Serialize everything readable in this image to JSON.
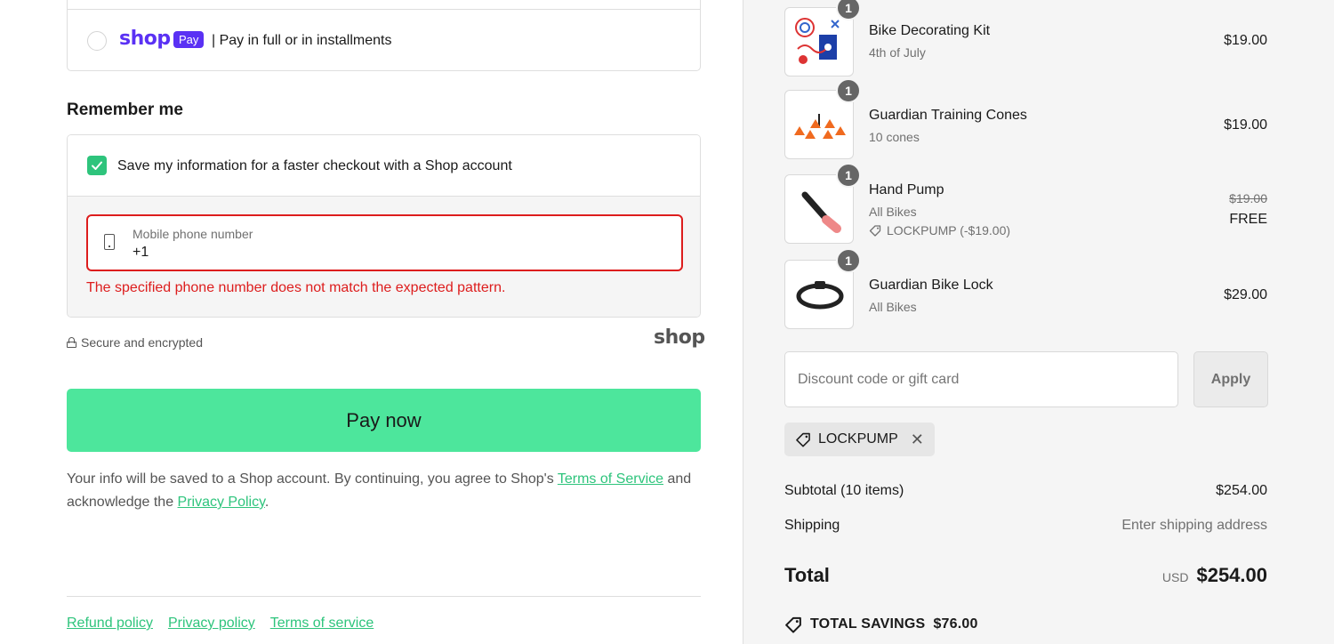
{
  "payment": {
    "shop_logo_text": "shop",
    "shop_pay_badge": "Pay",
    "description": "| Pay in full or in installments"
  },
  "remember": {
    "title": "Remember me",
    "save_label": "Save my information for a faster checkout with a Shop account",
    "checked": true,
    "phone_label": "Mobile phone number",
    "phone_value": "+1",
    "phone_error": "The specified phone number does not match the expected pattern."
  },
  "secure": {
    "text": "Secure and encrypted",
    "wordmark": "shop"
  },
  "pay_button": "Pay now",
  "legal": {
    "pre": "Your info will be saved to a Shop account. By continuing, you agree to Shop's ",
    "terms_link": "Terms of Service",
    "mid": " and acknowledge the ",
    "privacy_link": "Privacy Policy",
    "post": "."
  },
  "footer": {
    "refund": "Refund policy",
    "privacy": "Privacy policy",
    "terms": "Terms of service"
  },
  "items": [
    {
      "qty": "1",
      "name": "Bike Decorating Kit",
      "variant": "4th of July",
      "price": "$19.00"
    },
    {
      "qty": "1",
      "name": "Guardian Training Cones",
      "variant": "10 cones",
      "price": "$19.00"
    },
    {
      "qty": "1",
      "name": "Hand Pump",
      "variant": "All Bikes",
      "discount": "LOCKPUMP (-$19.00)",
      "original_price": "$19.00",
      "price": "FREE"
    },
    {
      "qty": "1",
      "name": "Guardian Bike Lock",
      "variant": "All Bikes",
      "price": "$29.00"
    }
  ],
  "discount": {
    "placeholder": "Discount code or gift card",
    "apply": "Apply",
    "applied_code": "LOCKPUMP"
  },
  "summary": {
    "subtotal_label": "Subtotal (10 items)",
    "subtotal_value": "$254.00",
    "shipping_label": "Shipping",
    "shipping_value": "Enter shipping address",
    "total_label": "Total",
    "total_currency": "USD",
    "total_value": "$254.00",
    "savings_label": "TOTAL SAVINGS",
    "savings_value": "$76.00"
  },
  "colors": {
    "accent_green": "#4de69c",
    "link_green": "#2ec47c",
    "shop_purple": "#5a31f4",
    "error_red": "#dd1d1d"
  }
}
